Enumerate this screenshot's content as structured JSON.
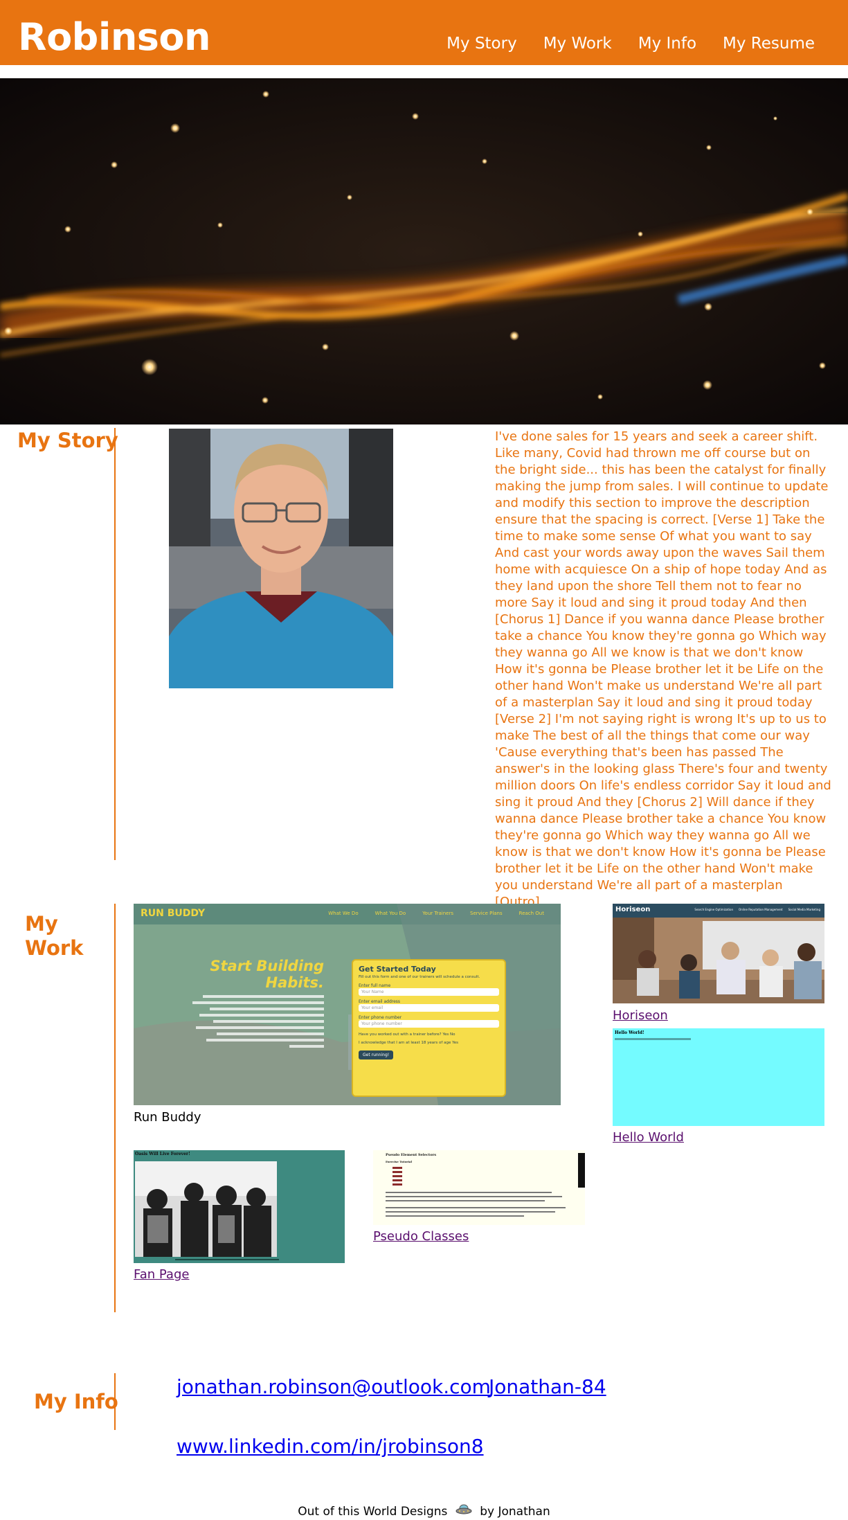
{
  "header": {
    "brand": "Robinson",
    "nav": [
      "My Story",
      "My Work",
      "My Info",
      "My Resume"
    ]
  },
  "colors": {
    "accent": "#E87411",
    "link": "#0000EE",
    "visited": "#5a0f6e"
  },
  "story": {
    "title": "My Story",
    "text": "I've done sales for 15 years and seek a career shift. Like many, Covid had thrown me off course but on the bright side... this has been the catalyst for finally making the jump from sales. I will continue to update and modify this section to improve the description ensure that the spacing is correct. [Verse 1] Take the time to make some sense Of what you want to say And cast your words away upon the waves Sail them home with acquiesce On a ship of hope today And as they land upon the shore Tell them not to fear no more Say it loud and sing it proud today And then [Chorus 1] Dance if you wanna dance Please brother take a chance You know they're gonna go Which way they wanna go All we know is that we don't know How it's gonna be Please brother let it be Life on the other hand Won't make us understand We're all part of a masterplan Say it loud and sing it proud today [Verse 2] I'm not saying right is wrong It's up to us to make The best of all the things that come our way 'Cause everything that's been has passed The answer's in the looking glass There's four and twenty million doors On life's endless corridor Say it loud and sing it proud And they [Chorus 2] Will dance if they wanna dance Please brother take a chance You know they're gonna go Which way they wanna go All we know is that we don't know How it's gonna be Please brother let it be Life on the other hand Won't make you understand We're all part of a masterplan [Outro]"
  },
  "work": {
    "title_line1": "My",
    "title_line2": "Work",
    "runbuddy": {
      "label": "Run Buddy",
      "logo": "RUN BUDDY",
      "nav": [
        "What We Do",
        "What You Do",
        "Your Trainers",
        "Service Plans",
        "Reach Out"
      ],
      "headline1": "Start Building",
      "headline2": "Habits.",
      "form_title": "Get Started Today",
      "form_sub": "Fill out this form and one of our trainers will schedule a consult.",
      "field1_label": "Enter full name",
      "field1_ph": "Your Name",
      "field2_label": "Enter email address",
      "field2_ph": "Your email",
      "field3_label": "Enter phone number",
      "field3_ph": "Your phone number",
      "question": "Have you worked out with a trainer before?",
      "yes": "Yes",
      "no": "No",
      "ack": "I acknowledge that I am at least 18 years of age",
      "submit": "Get running!"
    },
    "horiseon": {
      "label": "Horiseon",
      "logo": "Horiseon",
      "nav": [
        "Search Engine Optimization",
        "Online Reputation Management",
        "Social Media Marketing"
      ]
    },
    "helloworld": {
      "label": "Hello World",
      "heading": "Hello World!"
    },
    "fanpage": {
      "label": "Fan Page",
      "heading": "Oasis Will Live Forever!"
    },
    "pseudo": {
      "label": "Pseudo Classes",
      "heading": "Pseudo Element Selectors",
      "sub": "Exercise Tutorial"
    }
  },
  "info": {
    "title": "My Info",
    "email": "jonathan.robinson@outlook.com",
    "github": "Jonathan-84",
    "linkedin": "www.linkedin.com/in/jrobinson8"
  },
  "footer": {
    "before": "Out of this World Designs",
    "after": "by Jonathan",
    "icon": "flying-saucer-icon"
  }
}
